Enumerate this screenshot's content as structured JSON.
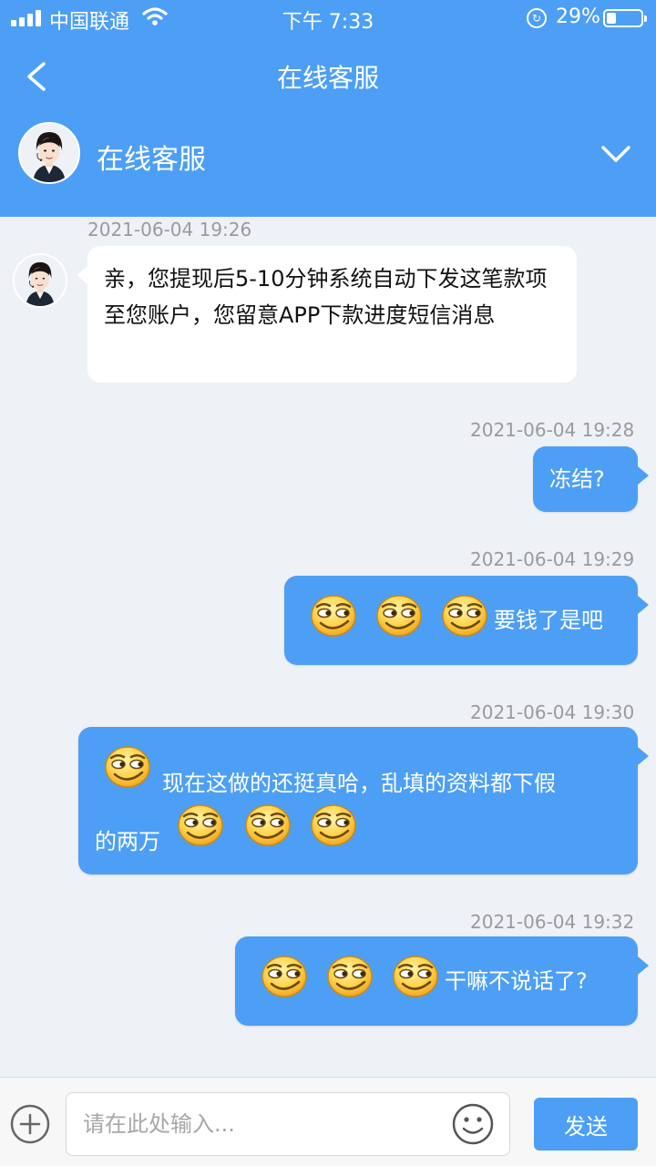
{
  "status_bar": {
    "carrier": "中国联通",
    "time": "下午 7:33",
    "battery": "29%"
  },
  "nav": {
    "title": "在线客服"
  },
  "agent": {
    "name": "在线客服"
  },
  "messages": [
    {
      "time": "2021-06-04 19:26",
      "direction": "incoming",
      "text": "亲，您提现后5-10分钟系统自动下发这笔款项至您账户，您留意APP下款进度短信消息"
    },
    {
      "time": "2021-06-04 19:28",
      "direction": "outgoing",
      "text": "冻结?"
    },
    {
      "time": "2021-06-04 19:29",
      "direction": "outgoing",
      "emoji_before": 3,
      "text": "要钱了是吧"
    },
    {
      "time": "2021-06-04 19:30",
      "direction": "outgoing",
      "text_line1": "现在这做的还挺真哈，乱填的资料都下假",
      "text_line2": "的两万",
      "emoji_before": 1,
      "emoji_after": 3
    },
    {
      "time": "2021-06-04 19:32",
      "direction": "outgoing",
      "emoji_before": 3,
      "text": "干嘛不说话了?"
    }
  ],
  "input": {
    "placeholder": "请在此处输入...",
    "send_label": "发送"
  },
  "icons": {
    "back": "back-arrow-icon",
    "expand": "chevron-down-icon",
    "add": "plus-circle-icon",
    "emoji_picker": "smiley-icon",
    "message_emoji": "smirk-emoji-icon"
  },
  "colors": {
    "brand": "#4d9ff5",
    "background": "#eef1f6"
  }
}
